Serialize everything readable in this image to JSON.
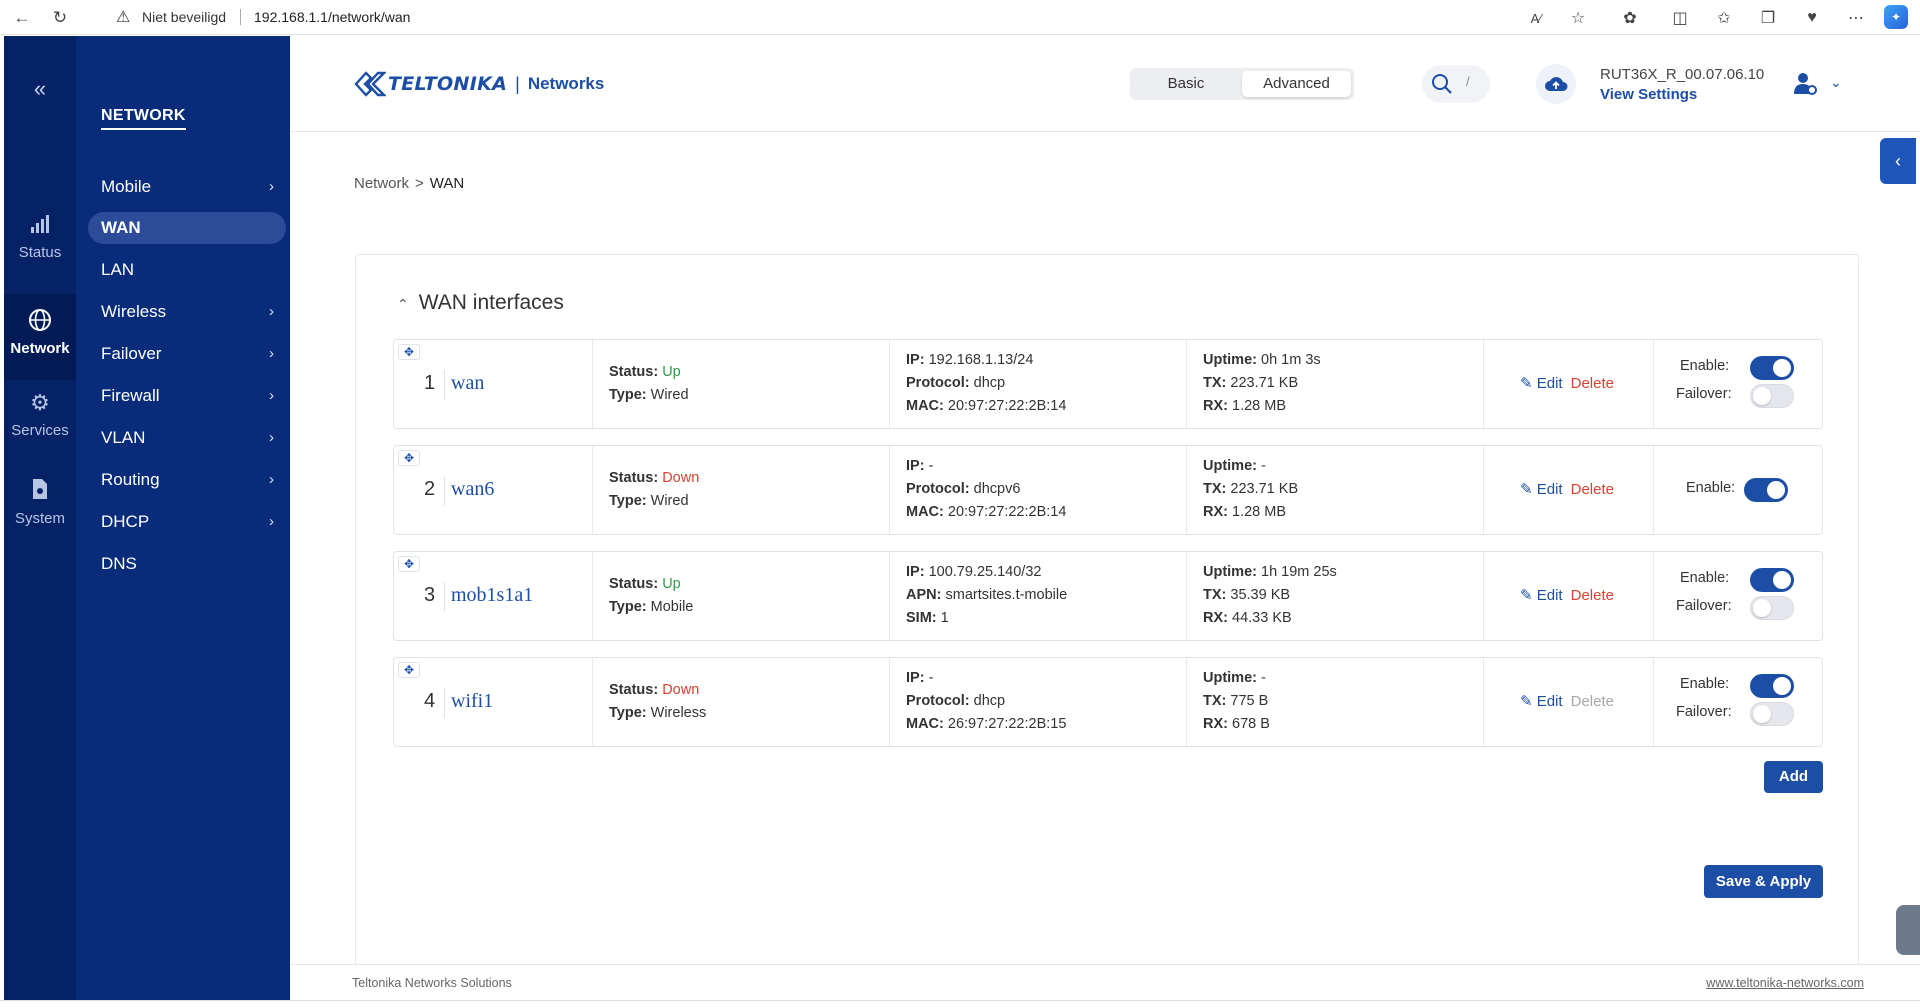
{
  "browser": {
    "security_label": "Niet beveiligd",
    "url": "192.168.1.1/network/wan",
    "icons": [
      "back-icon",
      "reload-icon",
      "warning-icon",
      "read-aloud-icon",
      "favorite-star-icon",
      "extensions-icon",
      "split-screen-icon",
      "favorites-icon",
      "collections-icon",
      "browser-essentials-icon",
      "more-icon",
      "copilot-icon"
    ]
  },
  "rail": {
    "items": [
      {
        "label": "Status",
        "icon": "signal-bars-icon"
      },
      {
        "label": "Network",
        "icon": "globe-icon"
      },
      {
        "label": "Services",
        "icon": "gear-icon"
      },
      {
        "label": "System",
        "icon": "file-gear-icon"
      }
    ]
  },
  "subnav": {
    "title": "NETWORK",
    "items": [
      {
        "label": "Mobile",
        "chevron": true
      },
      {
        "label": "WAN",
        "chevron": false
      },
      {
        "label": "LAN",
        "chevron": false
      },
      {
        "label": "Wireless",
        "chevron": true
      },
      {
        "label": "Failover",
        "chevron": true
      },
      {
        "label": "Firewall",
        "chevron": true
      },
      {
        "label": "VLAN",
        "chevron": true
      },
      {
        "label": "Routing",
        "chevron": true
      },
      {
        "label": "DHCP",
        "chevron": true
      },
      {
        "label": "DNS",
        "chevron": false
      }
    ]
  },
  "header": {
    "logo_text": "TELTONIKA",
    "logo_sep": "|",
    "logo_sub": "Networks",
    "mode_basic": "Basic",
    "mode_advanced": "Advanced",
    "search_shortcut": "/",
    "firmware": "RUT36X_R_00.07.06.10",
    "view_settings": "View Settings"
  },
  "breadcrumb": {
    "parent": "Network",
    "separator": ">",
    "current": "WAN"
  },
  "section": {
    "title": "WAN interfaces"
  },
  "labels": {
    "status": "Status:",
    "type": "Type:",
    "ip": "IP:",
    "protocol": "Protocol:",
    "mac": "MAC:",
    "apn": "APN:",
    "sim": "SIM:",
    "uptime": "Uptime:",
    "tx": "TX:",
    "rx": "RX:",
    "edit": "Edit",
    "delete": "Delete",
    "enable": "Enable:",
    "failover": "Failover:"
  },
  "interfaces": [
    {
      "num": "1",
      "name": "wan",
      "status": "Up",
      "type": "Wired",
      "ip": "192.168.1.13/24",
      "protocol": "dhcp",
      "mac": "20:97:27:22:2B:14",
      "uptime": "0h 1m 3s",
      "tx": "223.71 KB",
      "rx": "1.28 MB",
      "enable": true,
      "failover": false
    },
    {
      "num": "2",
      "name": "wan6",
      "status": "Down",
      "type": "Wired",
      "ip": "-",
      "protocol": "dhcpv6",
      "mac": "20:97:27:22:2B:14",
      "uptime": "-",
      "tx": "223.71 KB",
      "rx": "1.28 MB",
      "enable": true
    },
    {
      "num": "3",
      "name": "mob1s1a1",
      "status": "Up",
      "type": "Mobile",
      "ip": "100.79.25.140/32",
      "apn": "smartsites.t-mobile",
      "sim": "1",
      "uptime": "1h 19m 25s",
      "tx": "35.39 KB",
      "rx": "44.33 KB",
      "enable": true,
      "failover": false
    },
    {
      "num": "4",
      "name": "wifi1",
      "status": "Down",
      "type": "Wireless",
      "ip": "-",
      "protocol": "dhcp",
      "mac": "26:97:27:22:2B:15",
      "uptime": "-",
      "tx": "775 B",
      "rx": "678 B",
      "enable": true,
      "failover": false
    }
  ],
  "buttons": {
    "add": "Add",
    "save_apply": "Save & Apply"
  },
  "footer": {
    "left": "Teltonika Networks Solutions",
    "right": "www.teltonika-networks.com"
  },
  "colors": {
    "rail_bg": "#062266",
    "subnav_bg": "#092c7a",
    "accent": "#1d4ea6",
    "status_up": "#2f9c4a",
    "status_down": "#d9422f"
  }
}
